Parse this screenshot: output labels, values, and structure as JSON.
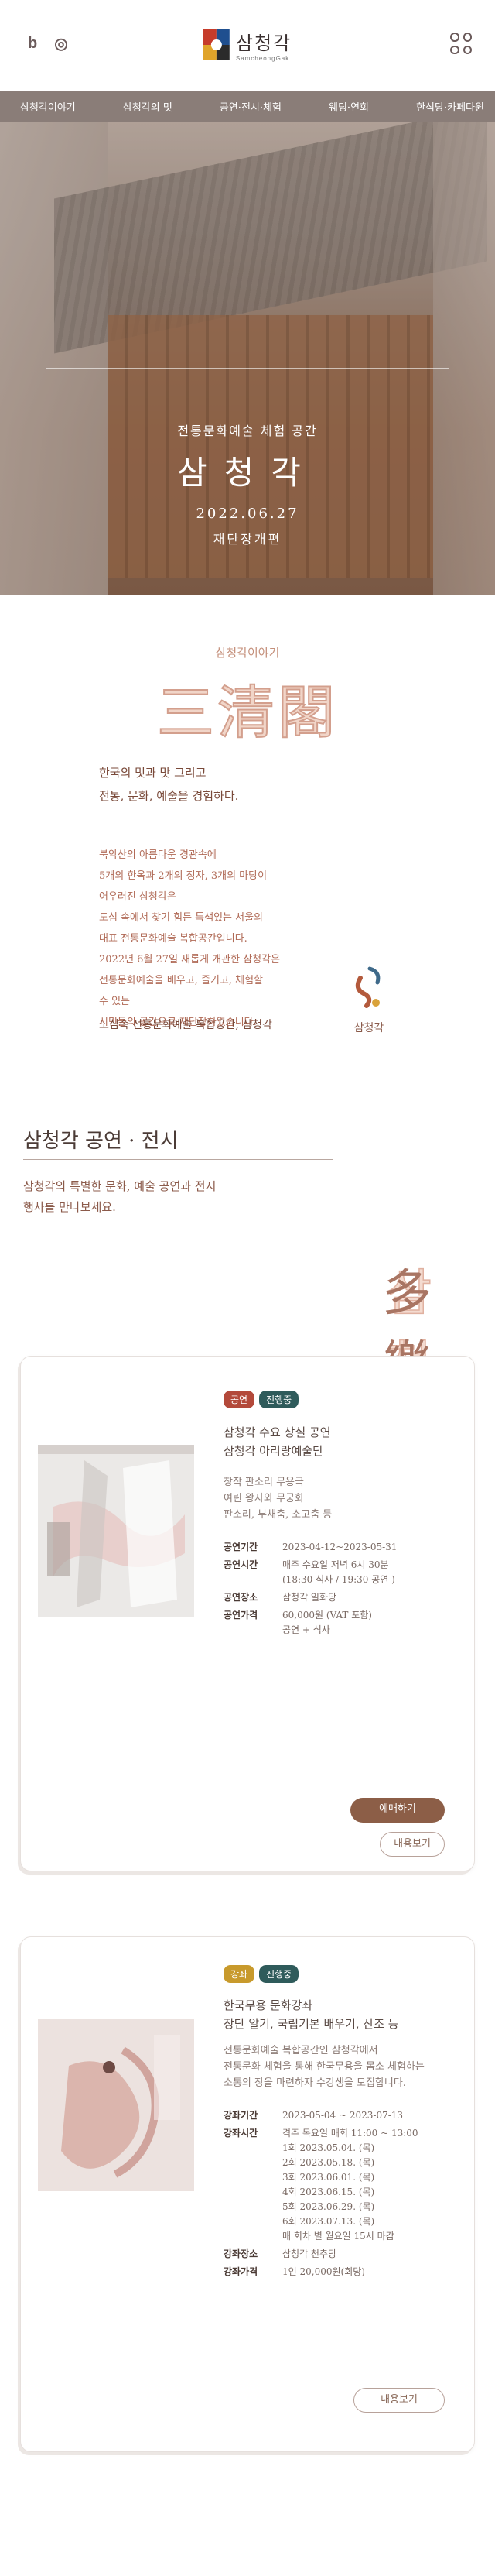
{
  "header": {
    "sns": [
      "b",
      "◎"
    ],
    "logo_text": "삼청각",
    "logo_sub": "SamcheongGak"
  },
  "nav": [
    "삼청각이야기",
    "삼청각의 멋",
    "공연·전시·체험",
    "웨딩·연회",
    "한식당·카페다원"
  ],
  "hero": {
    "subtitle": "전통문화예술 체험 공간",
    "title": "삼청각",
    "date": "2022.06.27",
    "date_caption": "재단장개편"
  },
  "story": {
    "label": "삼청각이야기",
    "hanja": "三清閣",
    "lead": [
      "한국의 멋과 맛 그리고",
      "전통, 문화, 예술을 경험하다."
    ],
    "body": [
      "북악산의 아름다운 경관속에",
      "5개의 한옥과 2개의 정자, 3개의 마당이",
      "어우러진 삼청각은",
      "도심 속에서 찾기 힘든 특색있는 서울의",
      "대표 전통문화예술 복합공간입니다.",
      "2022년 6월 27일 새롭게 개관한 삼청각은",
      "전통문화예술을 배우고, 즐기고, 체험할",
      "수 있는",
      "시민들의 공간으로 재단장하였습니다."
    ],
    "foot": "도심속 전통문화예술 복합공간, 삼청각",
    "seal_text": "삼청각"
  },
  "section": {
    "title": "삼청각 공연 · 전시",
    "desc": [
      "삼청각의 특별한 문화, 예술 공연과 전시",
      "행사를 만나보세요."
    ],
    "hanja1": "삼청",
    "hanja2": "多樂"
  },
  "cards": [
    {
      "badges": [
        {
          "label": "공연",
          "color": "#b3493a"
        },
        {
          "label": "진행중",
          "color": "#2f5b5b"
        }
      ],
      "title": [
        "삼청각 수요 상설 공연",
        "삼청각 아리랑예술단"
      ],
      "desc": [
        "창작 판소리 무용극",
        "여린 왕자와 무궁화",
        "판소리, 부채춤, 소고춤 등"
      ],
      "rows": [
        {
          "k": "공연기간",
          "v": [
            "2023-04-12~2023-05-31"
          ]
        },
        {
          "k": "공연시간",
          "v": [
            "매주 수요일 저녁 6시 30분",
            "(18:30 식사 / 19:30 공연 )"
          ]
        },
        {
          "k": "공연장소",
          "v": [
            "삼청각 일화당"
          ]
        },
        {
          "k": "공연가격",
          "v": [
            "60,000원 (VAT 포함)",
            "공연 + 식사"
          ]
        }
      ],
      "primary_button": "예매하기",
      "secondary_button": "내용보기"
    },
    {
      "badges": [
        {
          "label": "강좌",
          "color": "#c89a2c"
        },
        {
          "label": "진행중",
          "color": "#2f5b5b"
        }
      ],
      "title": [
        "한국무용 문화강좌",
        "장단 알기, 국립기본 배우기, 산조 등"
      ],
      "desc": [
        "전통문화예술 복합공간인 삼청각에서",
        "전통문화 체험을 통해 한국무용을 몸소 체험하는",
        "소통의 장을 마련하자 수강생을 모집합니다."
      ],
      "rows": [
        {
          "k": "강좌기간",
          "v": [
            "2023-05-04 ~ 2023-07-13"
          ]
        },
        {
          "k": "강좌시간",
          "v": [
            "격주 목요일 매회 11:00 ~ 13:00",
            "1회 2023.05.04. (목)",
            "2회 2023.05.18. (목)",
            "3회 2023.06.01. (목)",
            "4회 2023.06.15. (목)",
            "5회 2023.06.29. (목)",
            "6회 2023.07.13. (목)",
            "매 회차 별 월요일 15시 마감"
          ]
        },
        {
          "k": "강좌장소",
          "v": [
            "삼청각 천추당"
          ]
        },
        {
          "k": "강좌가격",
          "v": [
            "1인 20,000원(회당)"
          ]
        }
      ],
      "secondary_button": "내용보기"
    }
  ]
}
